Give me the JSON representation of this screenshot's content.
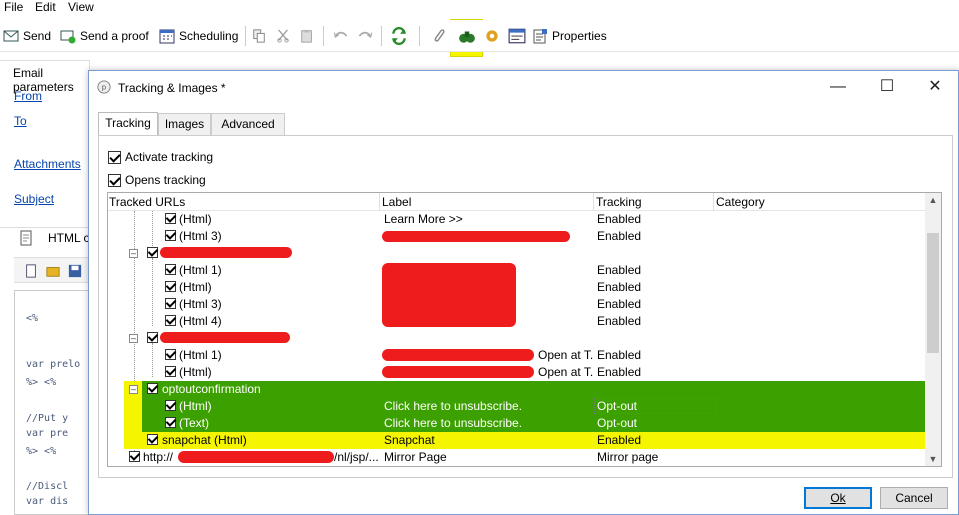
{
  "menu": [
    "File",
    "Edit",
    "View"
  ],
  "toolbar": {
    "send": "Send",
    "send_proof": "Send a proof",
    "scheduling": "Scheduling",
    "properties": "Properties",
    "highlight_color": "#f5f500"
  },
  "left": {
    "section": "Email parameters",
    "from": "From",
    "to": "To",
    "attachments": "Attachments",
    "subject": "Subject",
    "html_tab": "HTML c",
    "code_lines": [
      "<%",
      "var prelo",
      "%> <%",
      "//Put y",
      "var pre",
      "%> <%",
      "//Discl",
      "var dis"
    ]
  },
  "dialog": {
    "title": "Tracking & Images *",
    "tabs": [
      "Tracking",
      "Images",
      "Advanced"
    ],
    "activate_tracking": "Activate tracking",
    "opens_tracking": "Opens tracking",
    "columns": [
      "Tracked URLs",
      "Label",
      "Tracking",
      "Category"
    ],
    "rows": [
      {
        "url": "(Html)",
        "label": "Learn More >>",
        "tracking": "Enabled"
      },
      {
        "url": "(Html 3)",
        "label": "",
        "tracking": "Enabled"
      },
      {
        "url": "",
        "label": "",
        "tracking": ""
      },
      {
        "url": "(Html 1)",
        "label": "",
        "tracking": "Enabled"
      },
      {
        "url": "(Html)",
        "label": "",
        "tracking": "Enabled"
      },
      {
        "url": "(Html 3)",
        "label": "",
        "tracking": "Enabled"
      },
      {
        "url": "(Html 4)",
        "label": "",
        "tracking": "Enabled"
      },
      {
        "url": "",
        "label": "",
        "tracking": ""
      },
      {
        "url": "(Html 1)",
        "label": "Open at T.",
        "tracking": "Enabled"
      },
      {
        "url": "(Html)",
        "label": "Open at T.",
        "tracking": "Enabled"
      },
      {
        "url": "optoutconfirmation",
        "label": "",
        "tracking": ""
      },
      {
        "url": "(Html)",
        "label": "Click here to unsubscribe.",
        "tracking": "Opt-out"
      },
      {
        "url": "(Text)",
        "label": "Click here to unsubscribe.",
        "tracking": "Opt-out"
      },
      {
        "url": "snapchat (Html)",
        "label": "Snapchat",
        "tracking": "Enabled"
      },
      {
        "url_start": "http://",
        "url_end": "/nl/jsp/...",
        "label": "Mirror Page",
        "tracking": "Mirror page"
      }
    ],
    "ok": "Ok",
    "cancel": "Cancel"
  },
  "colors": {
    "green_highlight": "#3ca000",
    "yellow_highlight": "#f5f500",
    "redaction": "#ee1c1c"
  }
}
